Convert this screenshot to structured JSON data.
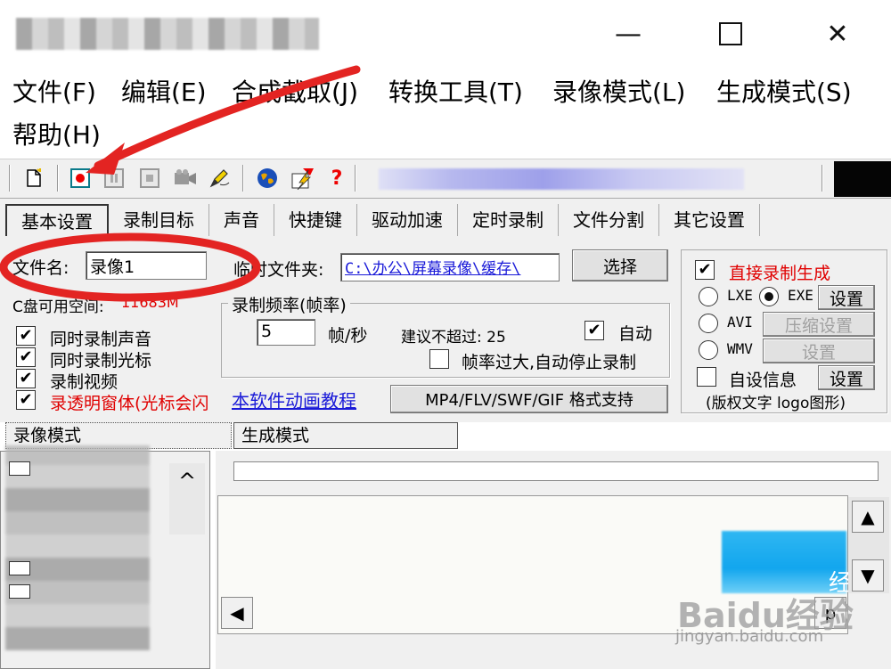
{
  "window": {
    "minimize_glyph": "—",
    "close_glyph": "✕"
  },
  "menu": {
    "file": "文件(F)",
    "edit": "编辑(E)",
    "compose_capture": "合成截取(J)",
    "convert_tools": "转换工具(T)",
    "record_mode": "录像模式(L)",
    "generate_mode": "生成模式(S)",
    "help": "帮助(H)"
  },
  "toolbar": {
    "icons": [
      "new-file-icon",
      "record-icon",
      "pause-icon",
      "stop-icon",
      "camera-icon",
      "pen-icon",
      "globe-icon",
      "flash-icon",
      "help-icon"
    ],
    "help_glyph": "?"
  },
  "tabs": [
    "基本设置",
    "录制目标",
    "声音",
    "快捷键",
    "驱动加速",
    "定时录制",
    "文件分割",
    "其它设置"
  ],
  "basic": {
    "filename_label": "文件名:",
    "filename_value": "录像1",
    "temp_folder_label": "临时文件夹:",
    "temp_folder_value": "C:\\办公\\屏幕录像\\缓存\\",
    "choose_button": "选择",
    "disk_space_label": "C盘可用空间:",
    "disk_space_value": "11683M",
    "checkboxes": [
      {
        "label": "同时录制声音",
        "checked": true
      },
      {
        "label": "同时录制光标",
        "checked": true
      },
      {
        "label": "录制视频",
        "checked": true
      },
      {
        "label": "录透明窗体(光标会闪",
        "checked": true
      }
    ],
    "check_glyph": "✔",
    "tutorial_link": "本软件动画教程",
    "format_button": "MP4/FLV/SWF/GIF  格式支持"
  },
  "framerate": {
    "group_title": "录制频率(帧率)",
    "value": "5",
    "unit": "帧/秒",
    "suggest": "建议不超过: 25",
    "auto_label": "自动",
    "auto_checked": true,
    "auto_stop_label": "帧率过大,自动停止录制",
    "auto_stop_checked": false
  },
  "output": {
    "direct_label": "直接录制生成",
    "direct_checked": true,
    "lxe_label": "LXE",
    "exe_label": "EXE",
    "exe_selected": true,
    "settings_button": "设置",
    "avi_label": "AVI",
    "compress_button": "压缩设置",
    "wmv_label": "WMV",
    "wmv_settings_button": "设置",
    "custom_info_label": "自设信息",
    "custom_info_checked": false,
    "custom_settings_button": "设置",
    "copyright_note": "(版权文字 logo图形)"
  },
  "bottom_tabs": {
    "record_mode": "录像模式",
    "generate_mode": "生成模式"
  },
  "scroll": {
    "up_glyph": "▲",
    "down_glyph": "▼",
    "left_glyph": "◀",
    "caret_up_glyph": "^",
    "right_label": "p"
  },
  "watermark": {
    "text": "Baidu经验",
    "sub": "jingyan.baidu.com",
    "blue_text": "经"
  },
  "colors": {
    "annotation_red": "#e32422",
    "link_blue": "#1a1ad8",
    "warning_red": "#e00000"
  }
}
